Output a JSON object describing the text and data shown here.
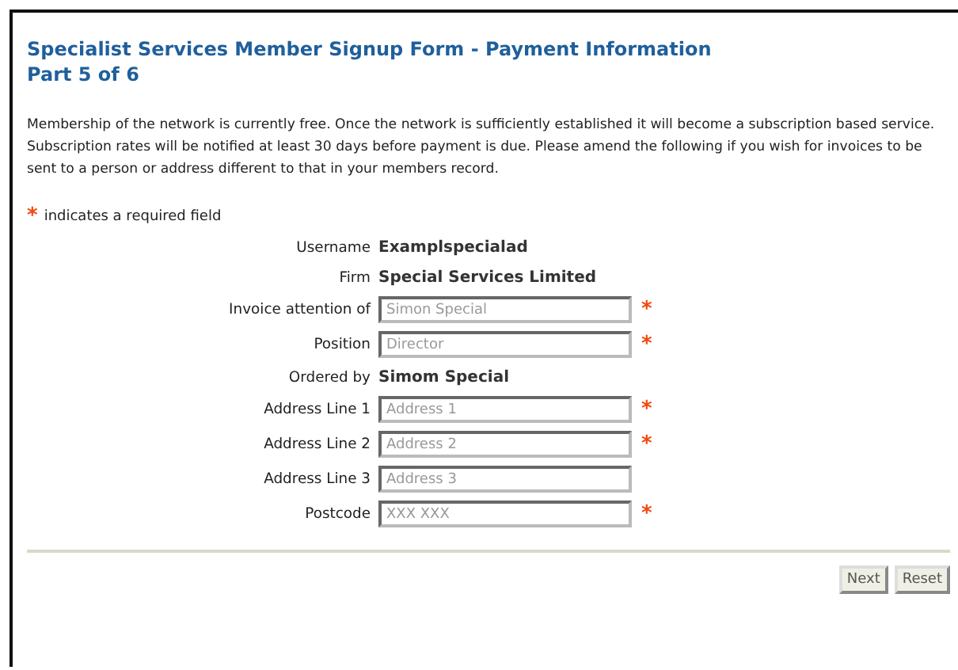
{
  "title": "Specialist Services Member Signup Form - Payment Information",
  "subtitle": "Part 5 of 6",
  "intro": "Membership of the network is currently free.  Once the network is sufficiently established it will become a subscription based service. Subscription rates will be notified at least 30 days before payment is due. Please amend the following if you wish for invoices to be sent to a person or address different to that in your members record.",
  "required_mark": "*",
  "required_note": "indicates a required field",
  "rows": [
    {
      "kind": "static",
      "label": "Username",
      "value": "Examplspecialad"
    },
    {
      "kind": "static",
      "label": "Firm",
      "value": "Special Services Limited"
    },
    {
      "kind": "input",
      "label": "Invoice attention of",
      "placeholder": "Simon Special",
      "required": true
    },
    {
      "kind": "input",
      "label": "Position",
      "placeholder": "Director",
      "required": true
    },
    {
      "kind": "static",
      "label": "Ordered by",
      "value": "Simom Special"
    },
    {
      "kind": "input",
      "label": "Address Line 1",
      "placeholder": "Address 1",
      "required": true
    },
    {
      "kind": "input",
      "label": "Address Line 2",
      "placeholder": "Address 2",
      "required": true
    },
    {
      "kind": "input",
      "label": "Address Line 3",
      "placeholder": "Address 3",
      "required": false
    },
    {
      "kind": "input",
      "label": "Postcode",
      "placeholder": "XXX XXX",
      "required": true
    }
  ],
  "buttons": [
    "Next",
    "Reset"
  ]
}
